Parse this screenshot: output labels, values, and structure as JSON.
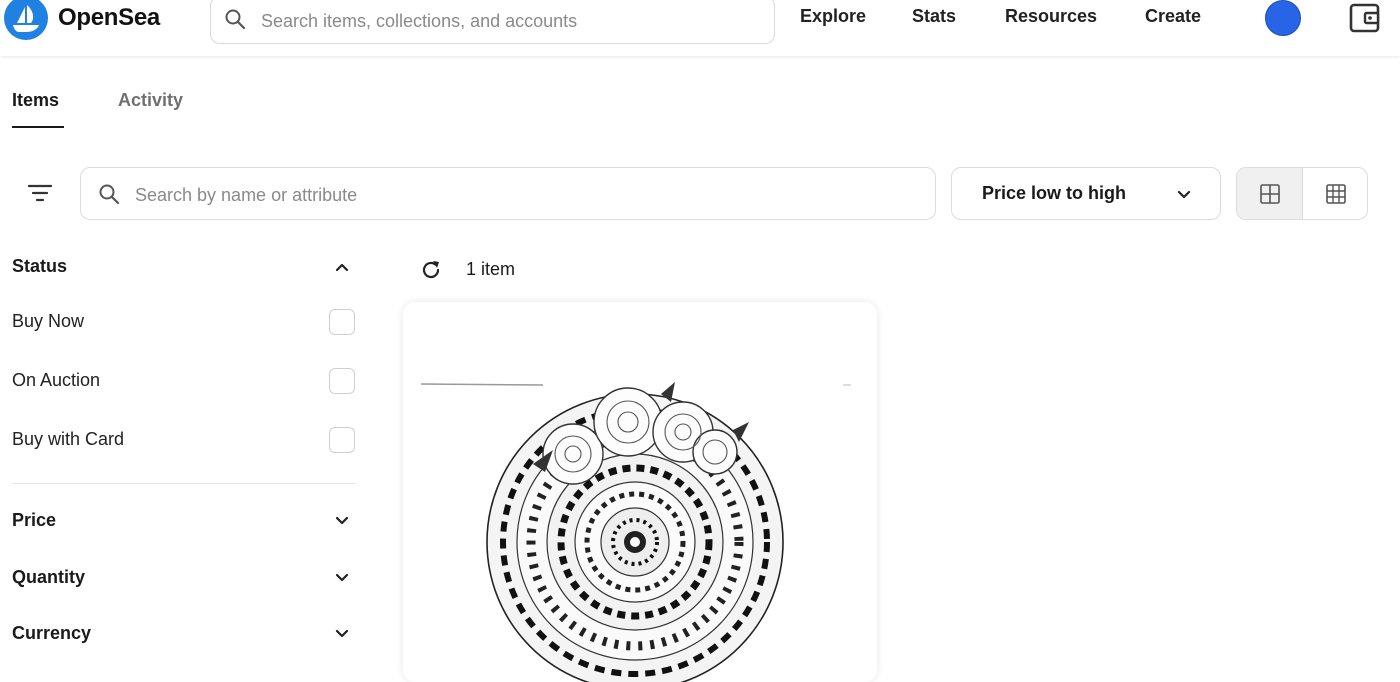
{
  "app": {
    "brand": "OpenSea"
  },
  "header": {
    "search_placeholder": "Search items, collections, and accounts",
    "nav": [
      {
        "label": "Explore"
      },
      {
        "label": "Stats"
      },
      {
        "label": "Resources"
      },
      {
        "label": "Create"
      }
    ],
    "icons": {
      "logo": "opensea-ship-icon",
      "search": "search-icon",
      "profile": "avatar",
      "wallet": "wallet-icon"
    },
    "colors": {
      "brand": "#2081e2",
      "avatar": "#2764e6"
    }
  },
  "tabs": [
    {
      "label": "Items",
      "active": true
    },
    {
      "label": "Activity",
      "active": false
    }
  ],
  "toolbar": {
    "filter_icon": "filter-icon",
    "search_placeholder": "Search by name or attribute",
    "sort_label": "Price low to high",
    "view_modes": [
      "large-grid-icon",
      "small-grid-icon"
    ],
    "selected_view": "large-grid-icon"
  },
  "sidebar": {
    "status": {
      "title": "Status",
      "expanded": true,
      "options": [
        {
          "label": "Buy Now",
          "checked": false
        },
        {
          "label": "On Auction",
          "checked": false
        },
        {
          "label": "Buy with Card",
          "checked": false
        }
      ]
    },
    "sections": [
      {
        "title": "Price",
        "expanded": false
      },
      {
        "title": "Quantity",
        "expanded": false
      },
      {
        "title": "Currency",
        "expanded": false
      }
    ]
  },
  "results": {
    "count_label": "1 item",
    "refresh_icon": "refresh-icon"
  }
}
